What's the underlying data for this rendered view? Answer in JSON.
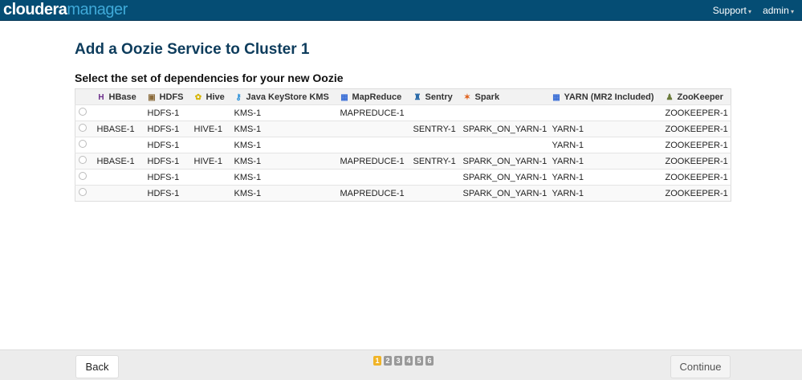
{
  "header": {
    "logo_brand": "cloudera",
    "logo_product": "manager",
    "nav": [
      "Support",
      "admin"
    ]
  },
  "title": "Add a Oozie Service to Cluster 1",
  "subtitle": "Select the set of dependencies for your new Oozie",
  "columns": [
    {
      "label": "HBase",
      "icon": "hbase-icon",
      "glyph": "H",
      "color": "#6b2e8a"
    },
    {
      "label": "HDFS",
      "icon": "hdfs-icon",
      "glyph": "▣",
      "color": "#8a6a3a"
    },
    {
      "label": "Hive",
      "icon": "hive-icon",
      "glyph": "✿",
      "color": "#d6b400"
    },
    {
      "label": "Java KeyStore KMS",
      "icon": "key-icon",
      "glyph": "⚷",
      "color": "#1e8ad6"
    },
    {
      "label": "MapReduce",
      "icon": "mapreduce-icon",
      "glyph": "▦",
      "color": "#3a6ed6"
    },
    {
      "label": "Sentry",
      "icon": "sentry-icon",
      "glyph": "♜",
      "color": "#2a6aa8"
    },
    {
      "label": "Spark",
      "icon": "spark-icon",
      "glyph": "✶",
      "color": "#e0601a"
    },
    {
      "label": "YARN (MR2 Included)",
      "icon": "yarn-icon",
      "glyph": "▦",
      "color": "#3a6ed6"
    },
    {
      "label": "ZooKeeper",
      "icon": "zookeeper-icon",
      "glyph": "♟",
      "color": "#6a7a3a"
    }
  ],
  "rows": [
    [
      "",
      "HDFS-1",
      "",
      "KMS-1",
      "MAPREDUCE-1",
      "",
      "",
      "",
      "ZOOKEEPER-1"
    ],
    [
      "HBASE-1",
      "HDFS-1",
      "HIVE-1",
      "KMS-1",
      "",
      "SENTRY-1",
      "SPARK_ON_YARN-1",
      "YARN-1",
      "ZOOKEEPER-1"
    ],
    [
      "",
      "HDFS-1",
      "",
      "KMS-1",
      "",
      "",
      "",
      "YARN-1",
      "ZOOKEEPER-1"
    ],
    [
      "HBASE-1",
      "HDFS-1",
      "HIVE-1",
      "KMS-1",
      "MAPREDUCE-1",
      "SENTRY-1",
      "SPARK_ON_YARN-1",
      "YARN-1",
      "ZOOKEEPER-1"
    ],
    [
      "",
      "HDFS-1",
      "",
      "KMS-1",
      "",
      "",
      "SPARK_ON_YARN-1",
      "YARN-1",
      "ZOOKEEPER-1"
    ],
    [
      "",
      "HDFS-1",
      "",
      "KMS-1",
      "MAPREDUCE-1",
      "",
      "SPARK_ON_YARN-1",
      "YARN-1",
      "ZOOKEEPER-1"
    ]
  ],
  "footer": {
    "back": "Back",
    "continue": "Continue",
    "steps": [
      "1",
      "2",
      "3",
      "4",
      "5",
      "6"
    ],
    "current_step": "1"
  }
}
